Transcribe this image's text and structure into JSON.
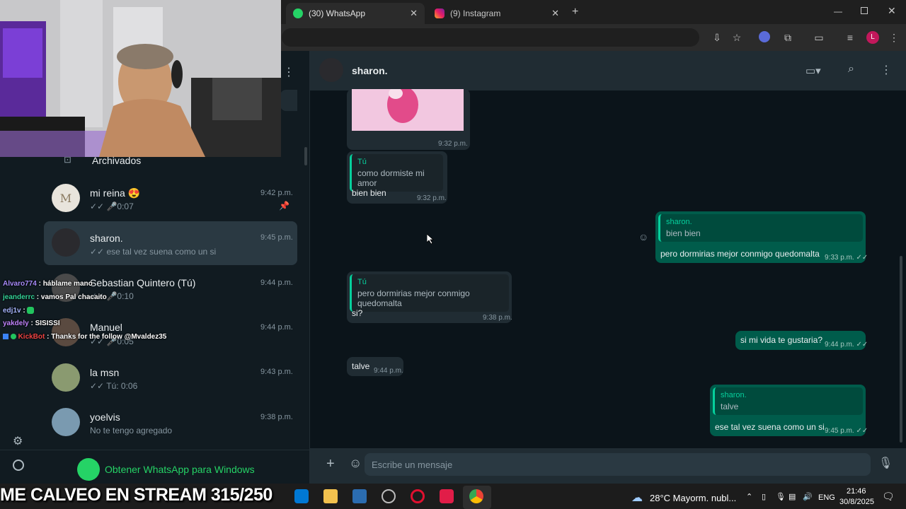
{
  "browser": {
    "tabs": [
      {
        "label": "(30) WhatsApp",
        "active": true
      },
      {
        "label": "(9) Instagram",
        "active": false
      }
    ],
    "new_tab": "+",
    "window_controls": [
      "minimize-icon",
      "maximize-icon",
      "close-icon"
    ],
    "profile_initial": "L"
  },
  "sidebar": {
    "archived_label": "Archivados",
    "chats": [
      {
        "name": "mi reina",
        "emoji": "😍",
        "time": "9:42 p.m.",
        "preview": "0:07",
        "ticks": "✓✓",
        "voice": true,
        "pinned": true,
        "avatar_color": "#e8e4dc"
      },
      {
        "name": "sharon.",
        "time": "9:45 p.m.",
        "preview": "ese tal vez suena como un si",
        "ticks": "✓✓",
        "selected": true,
        "avatar_color": "#2a2a2e"
      },
      {
        "name": "Sebastian Quintero (Tú)",
        "time": "9:44 p.m.",
        "preview": "0:10",
        "ticks": "✓✓",
        "voice": true,
        "avatar_color": "#4a4a4a"
      },
      {
        "name": "Manuel",
        "time": "9:44 p.m.",
        "preview": "0:05",
        "ticks": "✓✓",
        "voice": true,
        "avatar_color": "#5a4a40"
      },
      {
        "name": "la msn",
        "time": "9:43 p.m.",
        "preview": "Tú: 0:06",
        "ticks": "✓✓",
        "voice": true,
        "avatar_color": "#8a9a70"
      },
      {
        "name": "yoelvis",
        "time": "9:38 p.m.",
        "preview": "No te tengo agregado",
        "avatar_color": "#7a9ab0"
      }
    ],
    "get_app_label": "Obtener WhatsApp para Windows"
  },
  "chat": {
    "contact_name": "sharon.",
    "messages": [
      {
        "dir": "in",
        "type": "image",
        "time": "9:32 p.m."
      },
      {
        "dir": "in",
        "quote_author": "Tú",
        "quote_text": "como dormiste mi amor",
        "text": "bien bien",
        "time": "9:32 p.m."
      },
      {
        "dir": "out",
        "quote_author": "sharon.",
        "quote_text": "bien bien",
        "text": "pero dormirias mejor conmigo quedomalta",
        "time": "9:33 p.m.",
        "ticks": "✓✓"
      },
      {
        "dir": "in",
        "quote_author": "Tú",
        "quote_text": "pero dormirias mejor conmigo quedomalta",
        "text": "si?",
        "time": "9:38 p.m."
      },
      {
        "dir": "out",
        "text": "si mi vida te gustaria?",
        "time": "9:44 p.m.",
        "ticks": "✓✓"
      },
      {
        "dir": "in",
        "text": "talve",
        "time": "9:44 p.m."
      },
      {
        "dir": "out",
        "quote_author": "sharon.",
        "quote_text": "talve",
        "text": "ese tal vez suena como un si",
        "time": "9:45 p.m.",
        "ticks": "✓✓"
      }
    ],
    "composer_placeholder": "Escribe un mensaje"
  },
  "stream_chat": [
    {
      "user": "Alvaro774",
      "color": "#a78bfa",
      "msg": "háblame mano"
    },
    {
      "user": "jeanderrc",
      "color": "#34d399",
      "msg": "vamos Pal chacaito"
    },
    {
      "user": "edj1v",
      "color": "#a5b4fc",
      "msg": "",
      "emote": true
    },
    {
      "user": "yakdely",
      "color": "#c084fc",
      "msg": "SISISSI"
    },
    {
      "user": "KickBot",
      "color": "#ef4444",
      "msg": "Thanks for the follow @Mvaldez35",
      "badges": true
    }
  ],
  "stream_banner": "ME CALVEO EN STREAM 315/250",
  "taskbar": {
    "weather_temp": "28°C",
    "weather_desc": "Mayorm. nubl...",
    "language": "ENG",
    "time": "21:46",
    "date": "30/8/2025"
  },
  "colors": {
    "accent": "#00a884",
    "outgoing_bubble": "#005c4b",
    "incoming_bubble": "#202c33",
    "quote_bar": "#06cf9c"
  }
}
